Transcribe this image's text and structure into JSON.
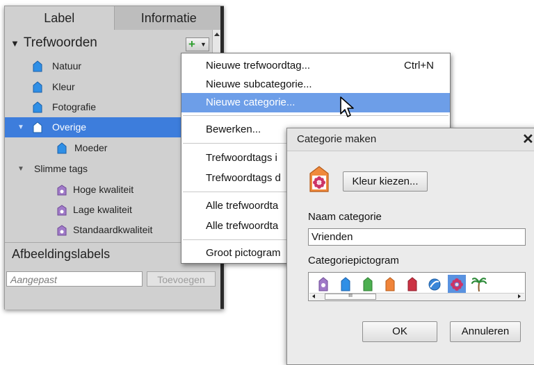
{
  "tabs": {
    "label": "Label",
    "info": "Informatie"
  },
  "tree": {
    "header": "Trefwoorden",
    "items": [
      {
        "label": "Natuur"
      },
      {
        "label": "Kleur"
      },
      {
        "label": "Fotografie"
      },
      {
        "label": "Overige"
      },
      {
        "label": "Moeder"
      }
    ],
    "smart_header": "Slimme tags",
    "smart_items": [
      {
        "label": "Hoge kwaliteit"
      },
      {
        "label": "Lage kwaliteit"
      },
      {
        "label": "Standaardkwaliteit"
      }
    ]
  },
  "footer": {
    "title": "Afbeeldingslabels",
    "input_placeholder": "Aangepast",
    "add_label": "Toevoegen"
  },
  "menu": {
    "items": [
      {
        "label": "Nieuwe trefwoordtag...",
        "shortcut": "Ctrl+N"
      },
      {
        "label": "Nieuwe subcategorie..."
      },
      {
        "label": "Nieuwe categorie..."
      },
      {
        "label": "Bewerken..."
      },
      {
        "label": "Trefwoordtags i"
      },
      {
        "label": "Trefwoordtags d"
      },
      {
        "label": "Alle trefwoordta"
      },
      {
        "label": "Alle trefwoordta"
      },
      {
        "label": "Groot pictogram"
      }
    ]
  },
  "dialog": {
    "title": "Categorie maken",
    "close": "✕",
    "color_button": "Kleur kiezen...",
    "name_label": "Naam categorie",
    "name_value": "Vrienden",
    "icon_label": "Categoriepictogram",
    "ok": "OK",
    "cancel": "Annuleren"
  },
  "colors": {
    "selection": "#3d7ddc",
    "menu_highlight": "#6d9ee8",
    "tag_blue": "#2f8fe6",
    "smart_purple": "#a07ac8"
  },
  "icons": {
    "tag": "tag-icon",
    "smart_tag": "smart-tag-icon",
    "add": "plus-icon",
    "cursor": "mouse-cursor-icon"
  }
}
